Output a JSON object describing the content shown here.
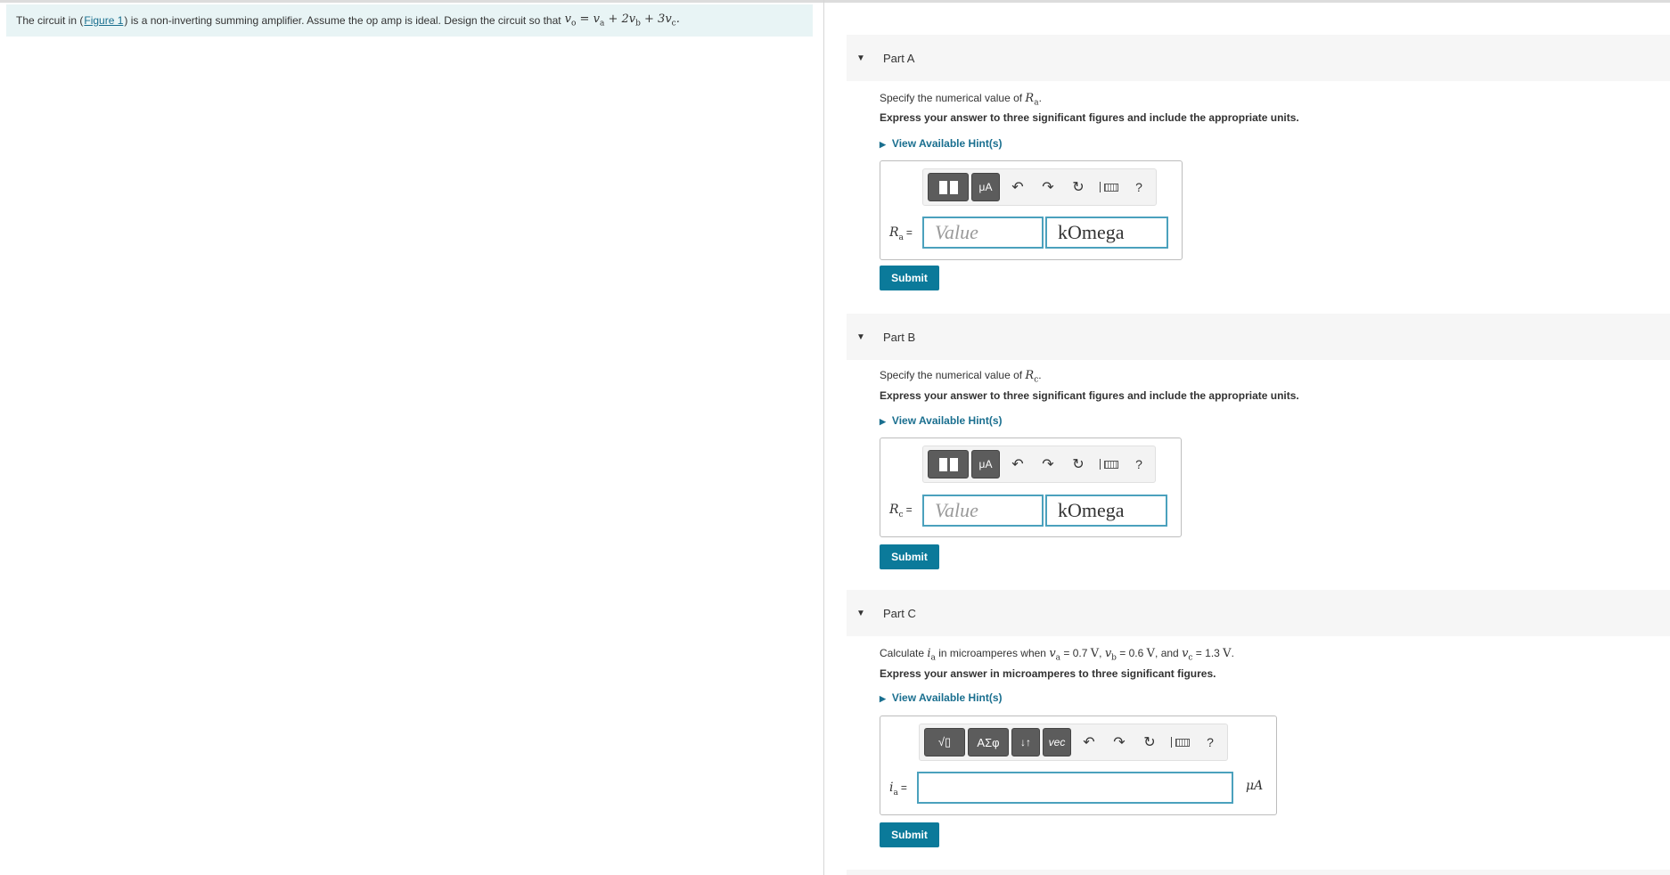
{
  "intro": {
    "text_before": "The circuit in (",
    "figure_link": "Figure 1",
    "text_after": ") is a non-inverting summing amplifier. Assume the op amp is ideal. Design the circuit so that",
    "eq": {
      "vo": "v",
      "o": "o",
      "eq1": " = ",
      "va": "v",
      "a": "a",
      "p1": " + 2",
      "vb": "v",
      "b": "b",
      "p2": " + 3",
      "vc": "v",
      "c": "c",
      "dot": "."
    }
  },
  "parts": {
    "a": {
      "title": "Part A",
      "prompt": "Specify the numerical value of ",
      "prompt_var": "R",
      "prompt_sub": "a",
      "instruction": "Express your answer to three significant figures and include the appropriate units.",
      "hint": "View Available Hint(s)",
      "var": "R",
      "var_sub": "a",
      "eq": "=",
      "value_placeholder": "Value",
      "unit_value": "kOmega",
      "submit": "Submit",
      "tb_units": "μA"
    },
    "b": {
      "title": "Part B",
      "prompt": "Specify the numerical value of ",
      "prompt_var": "R",
      "prompt_sub": "c",
      "instruction": "Express your answer to three significant figures and include the appropriate units.",
      "hint": "View Available Hint(s)",
      "var": "R",
      "var_sub": "c",
      "eq": "=",
      "value_placeholder": "Value",
      "unit_value": "kOmega",
      "submit": "Submit",
      "tb_units": "μA"
    },
    "c": {
      "title": "Part C",
      "prompt1": "Calculate ",
      "ia": "i",
      "ia_sub": "a",
      "prompt2": " in microamperes when ",
      "va": "v",
      "va_sub": "a",
      "va_val": " = 0.7 ",
      "vu1": "V",
      "sep1": ", ",
      "vb": "v",
      "vb_sub": "b",
      "vb_val": " = 0.6 ",
      "vu2": "V",
      "sep2": ", and ",
      "vc": "v",
      "vc_sub": "c",
      "vc_val": " = 1.3 ",
      "vu3": "V",
      "dot": ".",
      "instruction": "Express your answer in microamperes to three significant figures.",
      "hint": "View Available Hint(s)",
      "var": "i",
      "var_sub": "a",
      "eq": "=",
      "unit": "μA",
      "submit": "Submit",
      "tb_sqrt": "√▯",
      "tb_greek": "ΑΣφ",
      "tb_arrows": "↓↑",
      "tb_vec": "vec"
    }
  },
  "toolbar": {
    "help": "?"
  }
}
